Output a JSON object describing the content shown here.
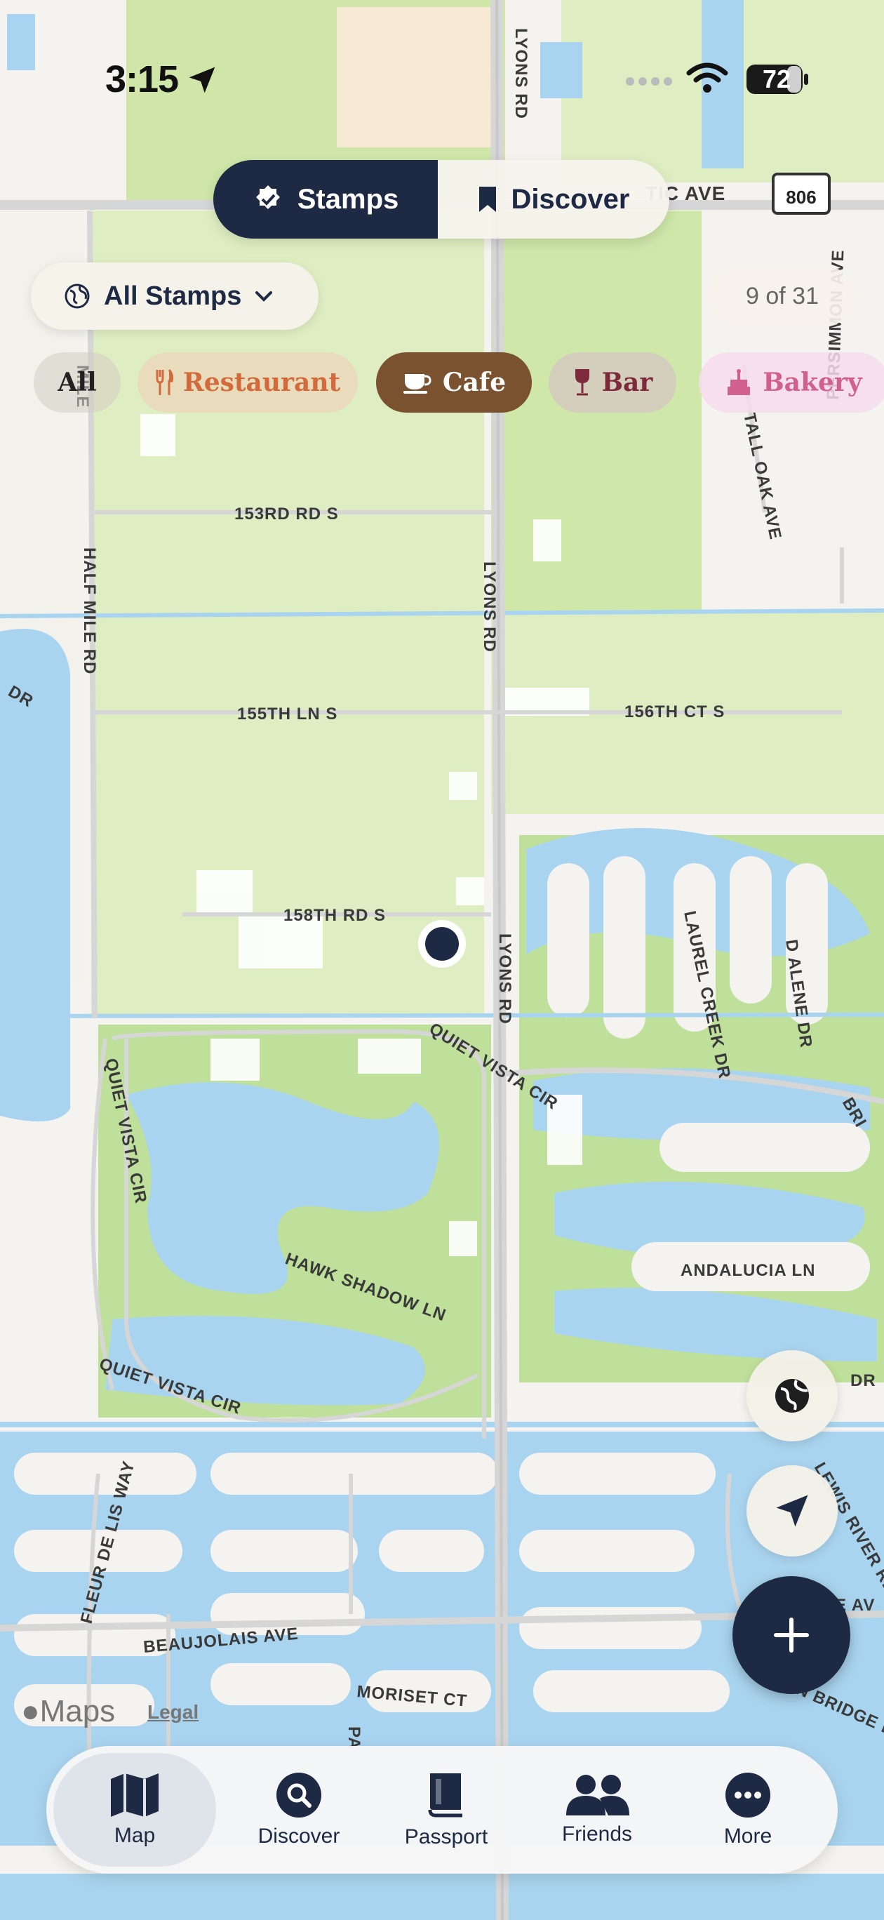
{
  "status": {
    "time": "3:15",
    "battery": "72"
  },
  "mode_toggle": {
    "stamps_label": "Stamps",
    "discover_label": "Discover",
    "active": "Stamps"
  },
  "filter": {
    "collection_label": "All Stamps",
    "count_label": "9 of 31"
  },
  "categories": [
    {
      "label": "All",
      "icon": "none",
      "color": "#222222"
    },
    {
      "label": "Restaurant",
      "icon": "fork-knife-icon",
      "color": "#d26a3c"
    },
    {
      "label": "Cafe",
      "icon": "coffee-cup-icon",
      "color": "#ffffff",
      "selected": true
    },
    {
      "label": "Bar",
      "icon": "wine-glass-icon",
      "color": "#7d2b3c"
    },
    {
      "label": "Bakery",
      "icon": "cake-icon",
      "color": "#d1608f"
    }
  ],
  "map": {
    "streets": [
      "LYONS RD",
      "153RD RD S",
      "155TH LN S",
      "156TH CT S",
      "158TH RD S",
      "HALF MILE RD",
      "QUIET VISTA CIR",
      "HAWK SHADOW LN",
      "LAUREL CREEK DR",
      "D ALENE DR",
      "ANDALUCIA LN",
      "TALL OAK AVE",
      "PERSIMMON AVE",
      "BEAUJOLAIS AVE",
      "MORISET CT",
      "FLEUR DE LIS WAY",
      "CROWN BRIDGE DR",
      "LEWIS RIVER RD",
      "TIC AVE",
      "806",
      "BRI",
      "MILE",
      "DR",
      "PA",
      "E AV"
    ],
    "attribution": {
      "brand": "Maps",
      "legal": "Legal"
    }
  },
  "floating_buttons": [
    "globe-icon",
    "navigation-arrow-icon",
    "plus-icon"
  ],
  "tabs": [
    {
      "label": "Map",
      "icon": "map-icon",
      "active": true
    },
    {
      "label": "Discover",
      "icon": "search-icon"
    },
    {
      "label": "Passport",
      "icon": "book-icon"
    },
    {
      "label": "Friends",
      "icon": "people-icon"
    },
    {
      "label": "More",
      "icon": "ellipsis-icon"
    }
  ],
  "colors": {
    "navy": "#1e2a44",
    "cafe_brown": "#7a5230",
    "water": "#a9d4ef",
    "park": "#c9e4a5"
  }
}
